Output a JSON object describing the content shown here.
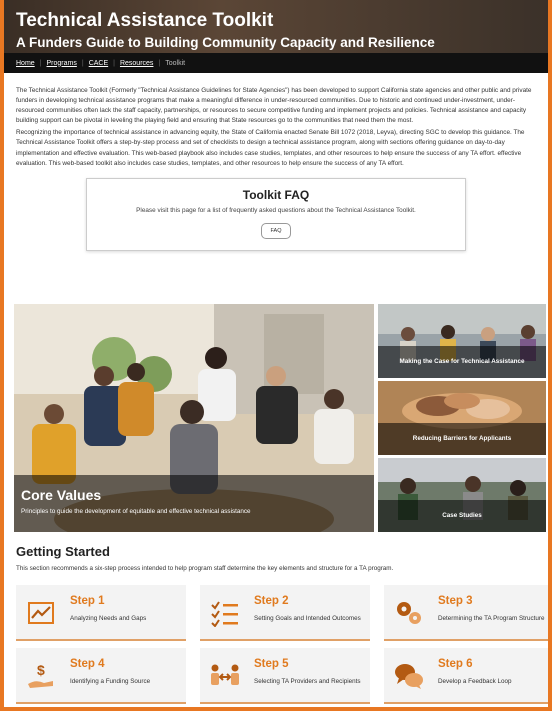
{
  "header": {
    "title": "Technical Assistance Toolkit",
    "subtitle": "A Funders Guide to Building Community Capacity and Resilience"
  },
  "breadcrumbs": [
    "Home",
    "Programs",
    "CACE",
    "Resources"
  ],
  "breadcrumb_current": "Toolkit",
  "intro": {
    "p1": "The Technical Assistance Toolkit (Formerly \"Technical Assistance Guidelines for State Agencies\") has been developed to support California state agencies and other public and private funders in developing technical assistance programs that make a meaningful difference in under-resourced communities. Due to historic and continued under-investment, under-resourced communities often lack the staff capacity, partnerships, or resources to secure competitive funding and implement projects and policies. Technical assistance and capacity building support can be pivotal in leveling the playing field and ensuring that State resources go to the communities that need them the most.",
    "p2": "Recognizing the importance of technical assistance in advancing equity, the State of California enacted Senate Bill 1072 (2018, Leyva), directing SGC to develop this guidance. The Technical Assistance Toolkit offers a step-by-step process and set of checklists to design a technical assistance program, along with sections offering guidance on day-to-day implementation and effective evaluation. This web-based playbook also includes case studies, templates, and other resources to help ensure the success of any TA effort. effective evaluation. This web-based toolkit also includes case studies, templates, and other resources to help ensure the success of any TA effort."
  },
  "faq": {
    "title": "Toolkit FAQ",
    "description": "Please visit this page for a list of frequently asked questions about the Technical Assistance Toolkit.",
    "button": "FAQ"
  },
  "core_values": {
    "title": "Core Values",
    "subtitle": "Principles to guide the development of equitable and effective technical assistance"
  },
  "side_tiles": [
    {
      "label": "Making the Case for Technical Assistance"
    },
    {
      "label": "Reducing Barriers for Applicants"
    },
    {
      "label": "Case Studies"
    }
  ],
  "getting_started": {
    "title": "Getting Started",
    "description": "This section recommends a six-step process intended to help program staff determine the key elements and structure for a TA program."
  },
  "steps": [
    {
      "title": "Step 1",
      "label": "Analyzing Needs and Gaps",
      "icon": "chart-trend-icon"
    },
    {
      "title": "Step 2",
      "label": "Setting Goals and Intended Outcomes",
      "icon": "checklist-icon"
    },
    {
      "title": "Step 3",
      "label": "Determining the TA Program Structure",
      "icon": "gears-icon"
    },
    {
      "title": "Step 4",
      "label": "Identifying a Funding Source",
      "icon": "dollar-hand-icon"
    },
    {
      "title": "Step 5",
      "label": "Selecting TA Providers and Recipients",
      "icon": "people-exchange-icon"
    },
    {
      "title": "Step 6",
      "label": "Develop a Feedback Loop",
      "icon": "chat-bubbles-icon"
    }
  ],
  "colors": {
    "accent": "#e07a1e",
    "border": "#e87722"
  }
}
